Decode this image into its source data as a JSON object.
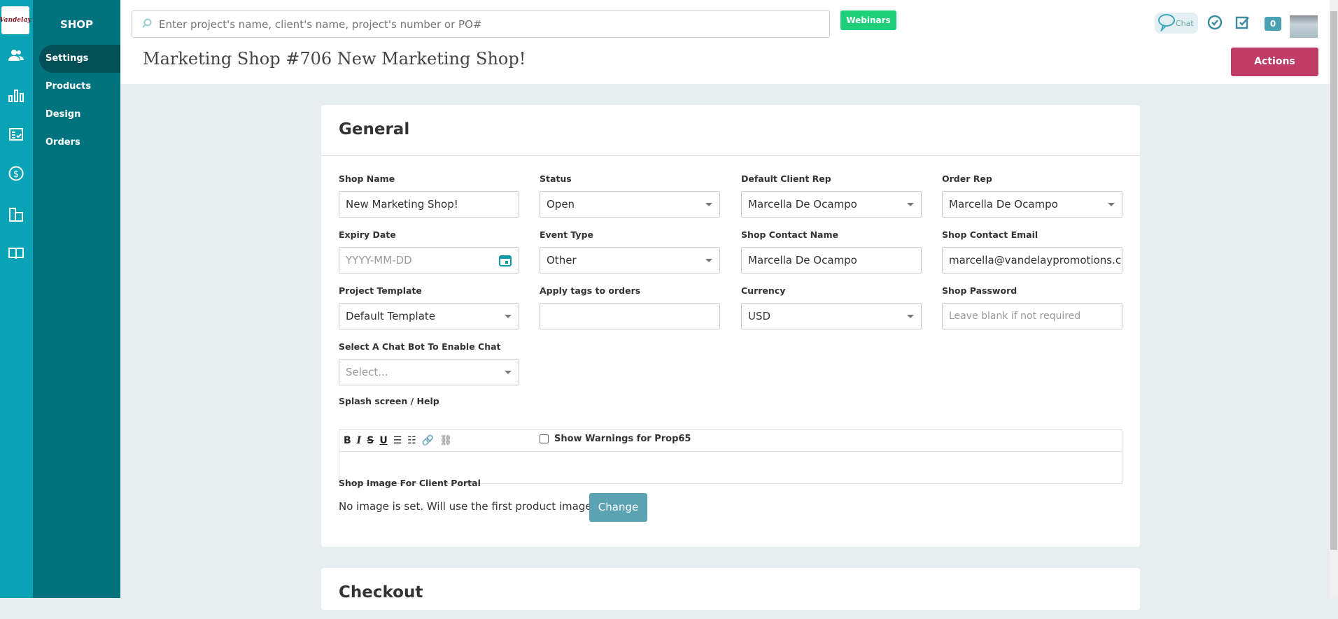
{
  "brand": {
    "logo_text": "Vandelay"
  },
  "rail": {
    "icons": [
      "users-icon",
      "bar-chart-icon",
      "checklist-icon",
      "dollar-icon",
      "building-icon",
      "book-icon"
    ]
  },
  "nav": {
    "title": "SHOP",
    "items": [
      {
        "label": "Settings"
      },
      {
        "label": "Products"
      },
      {
        "label": "Design"
      },
      {
        "label": "Orders"
      }
    ]
  },
  "header": {
    "search_placeholder": "Enter project's name, client's name, project's number or PO#",
    "webinars": "Webinars",
    "chat": "Chat",
    "notification_count": "0",
    "title": "Marketing Shop #706 New Marketing Shop!",
    "actions": "Actions"
  },
  "general": {
    "title": "General",
    "shop_name": {
      "label": "Shop Name",
      "value": "New Marketing Shop!"
    },
    "status": {
      "label": "Status",
      "value": "Open"
    },
    "default_client_rep": {
      "label": "Default Client Rep",
      "value": "Marcella De Ocampo"
    },
    "order_rep": {
      "label": "Order Rep",
      "value": "Marcella De Ocampo"
    },
    "expiry_date": {
      "label": "Expiry Date",
      "placeholder": "YYYY-MM-DD"
    },
    "event_type": {
      "label": "Event Type",
      "value": "Other"
    },
    "shop_contact_name": {
      "label": "Shop Contact Name",
      "value": "Marcella De Ocampo"
    },
    "shop_contact_email": {
      "label": "Shop Contact Email",
      "value": "marcella@vandelaypromotions.com"
    },
    "project_template": {
      "label": "Project Template",
      "value": "Default Template"
    },
    "apply_tags": {
      "label": "Apply tags to orders",
      "value": ""
    },
    "currency": {
      "label": "Currency",
      "value": "USD"
    },
    "shop_password": {
      "label": "Shop Password",
      "placeholder": "Leave blank if not required"
    },
    "chat_bot": {
      "label": "Select A Chat Bot To Enable Chat",
      "placeholder": "Select..."
    },
    "prop65": {
      "label": "Show Warnings for Prop65",
      "checked": false
    },
    "splash": {
      "label": "Splash screen / Help"
    },
    "shop_image": {
      "label": "Shop Image For Client Portal",
      "text": "No image is set. Will use the first product image.",
      "button": "Change"
    }
  },
  "checkout": {
    "title": "Checkout"
  }
}
